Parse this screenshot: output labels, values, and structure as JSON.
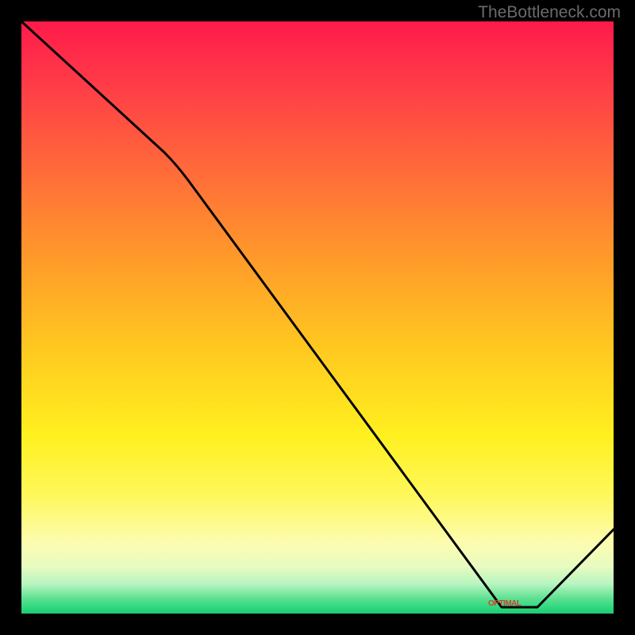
{
  "watermark": "TheBottleneck.com",
  "chart_data": {
    "type": "line",
    "title": "",
    "xlabel": "",
    "ylabel": "",
    "x": [
      0,
      24,
      81,
      87,
      100
    ],
    "y": [
      100,
      78,
      0,
      0,
      14
    ],
    "xlim": [
      0,
      100
    ],
    "ylim": [
      0,
      100
    ],
    "annotations": [
      {
        "text": "OPTIMAL",
        "x": 84,
        "y": 1
      }
    ],
    "gradient_zones": [
      {
        "color": "#ff1a4a",
        "position": 0
      },
      {
        "color": "#ffc820",
        "position": 55
      },
      {
        "color": "#fcfcb0",
        "position": 88
      },
      {
        "color": "#22c870",
        "position": 100
      }
    ],
    "description": "Bottleneck curve descending from top-left, reaching minimum (optimal zone) around x=81-87, then rising slightly"
  },
  "label_bottom": "OPTIMAL"
}
